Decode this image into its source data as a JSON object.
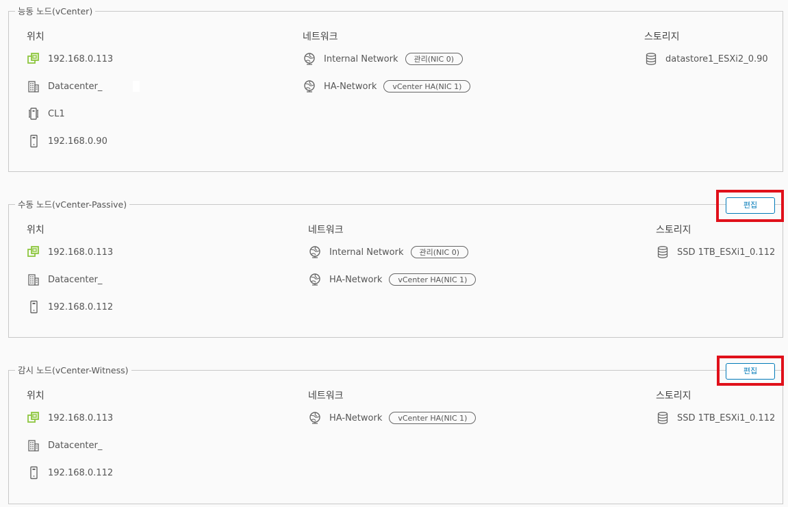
{
  "headers": {
    "location": "위치",
    "network": "네트워크",
    "storage": "스토리지"
  },
  "edit_label": "편집",
  "active": {
    "title": "능동 노드(vCenter)",
    "location": [
      "192.168.0.113",
      "Datacenter_",
      "CL1",
      "192.168.0.90"
    ],
    "network": [
      {
        "name": "Internal Network",
        "badge": "관리(NIC 0)"
      },
      {
        "name": "HA-Network",
        "badge": "vCenter HA(NIC 1)"
      }
    ],
    "storage": [
      "datastore1_ESXi2_0.90"
    ]
  },
  "passive": {
    "title": "수동 노드(vCenter-Passive)",
    "location": [
      "192.168.0.113",
      "Datacenter_",
      "192.168.0.112"
    ],
    "network": [
      {
        "name": "Internal Network",
        "badge": "관리(NIC 0)"
      },
      {
        "name": "HA-Network",
        "badge": "vCenter HA(NIC 1)"
      }
    ],
    "storage": [
      "SSD 1TB_ESXi1_0.112"
    ]
  },
  "witness": {
    "title": "감시 노드(vCenter-Witness)",
    "location": [
      "192.168.0.113",
      "Datacenter_",
      "192.168.0.112"
    ],
    "network": [
      {
        "name": "HA-Network",
        "badge": "vCenter HA(NIC 1)"
      }
    ],
    "storage": [
      "SSD 1TB_ESXi1_0.112"
    ]
  },
  "icons": {
    "vcenter": "vcenter-host-icon",
    "datacenter": "datacenter-icon",
    "cluster": "cluster-icon",
    "host": "host-server-icon",
    "network": "network-globe-icon",
    "datastore": "datastore-icon"
  },
  "colors": {
    "accent": "#0079b8",
    "highlight": "#e0101a",
    "vcenter_icon": "#8dc63f"
  }
}
